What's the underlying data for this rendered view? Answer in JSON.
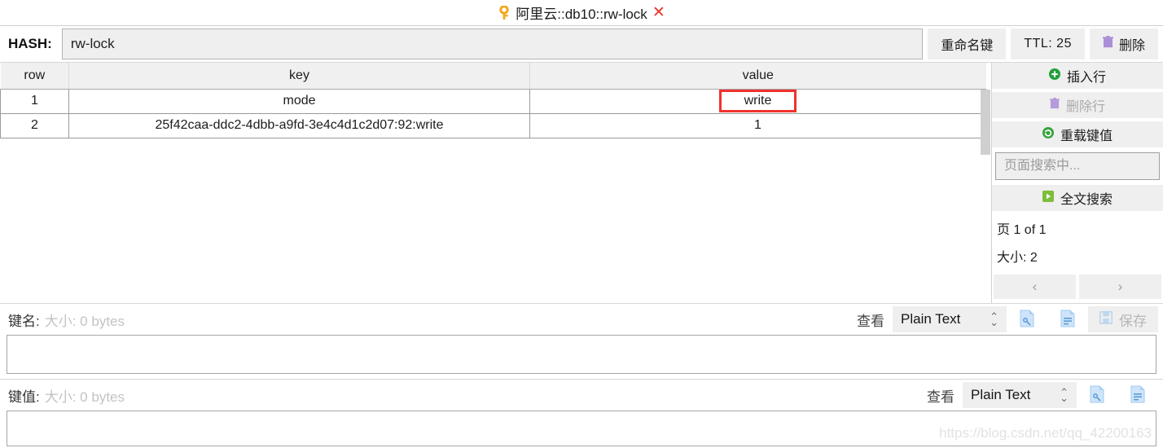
{
  "window": {
    "title": "阿里云::db10::rw-lock",
    "key_icon": "key-icon",
    "close_label": "✕"
  },
  "keybar": {
    "type_label": "HASH:",
    "key_value": "rw-lock",
    "rename_label": "重命名键",
    "ttl_label": "TTL: 25",
    "delete_label": "删除",
    "delete_icon": "trash-icon"
  },
  "table": {
    "columns": [
      "row",
      "key",
      "value"
    ],
    "rows": [
      {
        "row": "1",
        "key": "mode",
        "value": "write",
        "highlighted": true
      },
      {
        "row": "2",
        "key": "25f42caa-ddc2-4dbb-a9fd-3e4c4d1c2d07:92:write",
        "value": "1",
        "highlighted": false
      }
    ]
  },
  "sidepanel": {
    "insert_row": "插入行",
    "delete_row": "删除行",
    "reload_value": "重载键值",
    "search_placeholder": "页面搜索中...",
    "full_search": "全文搜索",
    "page_text": "页  1  of 1",
    "size_text": "大小: 2",
    "prev_label": "‹",
    "next_label": "›"
  },
  "editors": [
    {
      "label": "键名:",
      "size_text": "大小: 0 bytes",
      "view_label": "查看",
      "format": "Plain Text",
      "content": "",
      "has_save": true,
      "save_label": "保存"
    },
    {
      "label": "键值:",
      "size_text": "大小: 0 bytes",
      "view_label": "查看",
      "format": "Plain Text",
      "content": "",
      "has_save": false,
      "save_label": ""
    }
  ],
  "watermark": "https://blog.csdn.net/qq_42200163",
  "colors": {
    "accent_red": "#f0322c",
    "green": "#2aa83a",
    "purple": "#ab8ed6",
    "blue": "#76b3ec"
  }
}
